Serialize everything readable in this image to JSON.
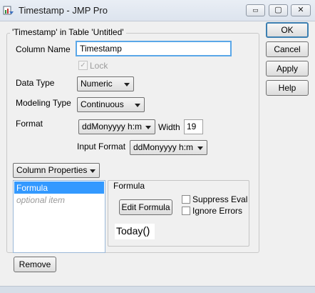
{
  "window": {
    "title": "Timestamp - JMP Pro",
    "controls": {
      "minimize": "▭",
      "maximize": "▢",
      "close": "✕"
    }
  },
  "group": {
    "title": "'Timestamp' in Table 'Untitled'"
  },
  "column_name": {
    "label": "Column Name",
    "value": "Timestamp"
  },
  "lock": {
    "label": "Lock",
    "checked": true
  },
  "data_type": {
    "label": "Data Type",
    "value": "Numeric"
  },
  "modeling_type": {
    "label": "Modeling Type",
    "value": "Continuous"
  },
  "format": {
    "label": "Format",
    "value": "ddMonyyyy h:m",
    "width_label": "Width",
    "width_value": "19"
  },
  "input_format": {
    "label": "Input Format",
    "value": "ddMonyyyy h:m"
  },
  "column_properties": {
    "label": "Column Properties",
    "items": [
      {
        "label": "Formula",
        "selected": true
      },
      {
        "label": "optional item",
        "selected": false
      }
    ],
    "remove_label": "Remove"
  },
  "formula_panel": {
    "title": "Formula",
    "edit_button": "Edit Formula",
    "suppress_eval_label": "Suppress Eval",
    "ignore_errors_label": "Ignore Errors",
    "expression_name": "Today",
    "expression_parens": "()"
  },
  "buttons": {
    "ok": "OK",
    "cancel": "Cancel",
    "apply": "Apply",
    "help": "Help"
  },
  "colors": {
    "accent_focus": "#5aa7e8",
    "selection": "#3399ff"
  }
}
